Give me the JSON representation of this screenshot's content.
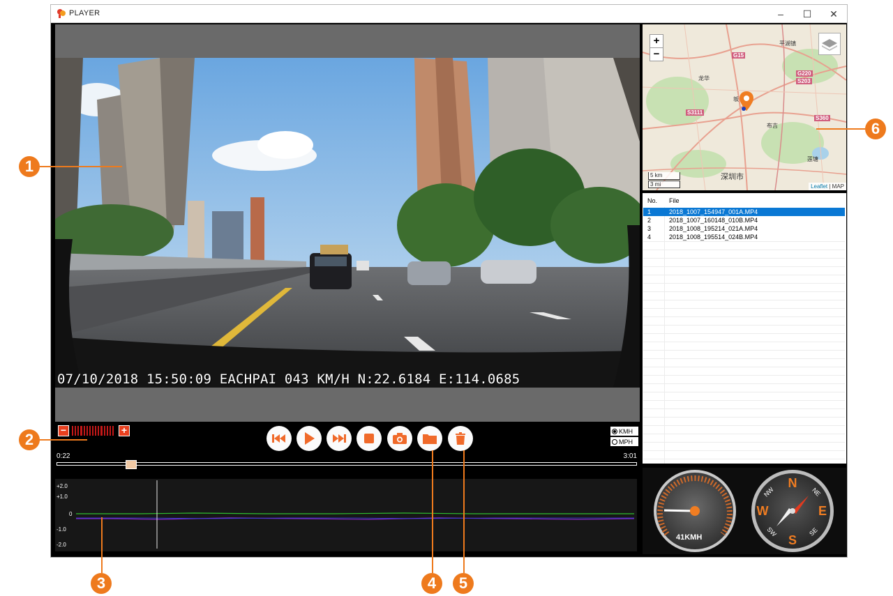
{
  "window": {
    "title": "PLAYER",
    "minimize_glyph": "–",
    "maximize_glyph": "☐",
    "close_glyph": "✕"
  },
  "video": {
    "overlay_text": "07/10/2018 15:50:09 EACHPAI 043 KM/H N:22.6184 E:114.0685"
  },
  "controls": {
    "volume_minus": "−",
    "volume_plus": "+",
    "volume_level": 1.0,
    "buttons": [
      {
        "name": "previous-button",
        "icon": "skip-previous-icon"
      },
      {
        "name": "play-button",
        "icon": "play-icon"
      },
      {
        "name": "next-button",
        "icon": "skip-next-icon"
      },
      {
        "name": "stop-button",
        "icon": "stop-icon"
      },
      {
        "name": "snapshot-button",
        "icon": "camera-icon"
      },
      {
        "name": "open-folder-button",
        "icon": "folder-icon"
      },
      {
        "name": "delete-button",
        "icon": "trash-icon"
      }
    ],
    "current_time": "0:22",
    "total_time": "3:01",
    "seek_fraction": 0.12,
    "unit_kmh": "KMH",
    "unit_mph": "MPH",
    "selected_unit": "KMH"
  },
  "graph": {
    "y_labels": [
      "+2.0",
      "+1.0",
      "0",
      "-1.0",
      "-2.0"
    ],
    "series_colors": [
      "#2fbf2f",
      "#8a2bd0",
      "#2a3fd8"
    ],
    "cursor_fraction": 0.145
  },
  "map": {
    "zoom_in": "+",
    "zoom_out": "−",
    "scale_km": "5 km",
    "scale_mi": "3 mi",
    "attribution_leaflet": "Leaflet",
    "attribution_sep": " | ",
    "attribution_map": "MAP",
    "city_label": "深圳市",
    "place_labels": [
      "平湖镇",
      "龙华",
      "坂",
      "布吉",
      "莲塘"
    ],
    "road_tags": [
      "G15",
      "G220",
      "S203",
      "S3111",
      "S360"
    ],
    "colors": {
      "land": "#f1ece0",
      "park": "#c8e1b3",
      "water": "#a9d1ea",
      "road": "#e8a08f",
      "marker": "#ef7d22"
    }
  },
  "filelist": {
    "col_no": "No.",
    "col_file": "File",
    "rows": [
      {
        "no": "1",
        "file": "2018_1007_154947_001A.MP4",
        "selected": true
      },
      {
        "no": "2",
        "file": "2018_1007_160148_010B.MP4",
        "selected": false
      },
      {
        "no": "3",
        "file": "2018_1008_195214_021A.MP4",
        "selected": false
      },
      {
        "no": "4",
        "file": "2018_1008_195514_024B.MP4",
        "selected": false
      }
    ]
  },
  "gauges": {
    "speed_text": "41KMH",
    "speed_value": 41,
    "compass_labels": [
      "N",
      "E",
      "S",
      "W",
      "NE",
      "SE",
      "SW",
      "NW"
    ]
  },
  "callouts": [
    "1",
    "2",
    "3",
    "4",
    "5",
    "6"
  ]
}
